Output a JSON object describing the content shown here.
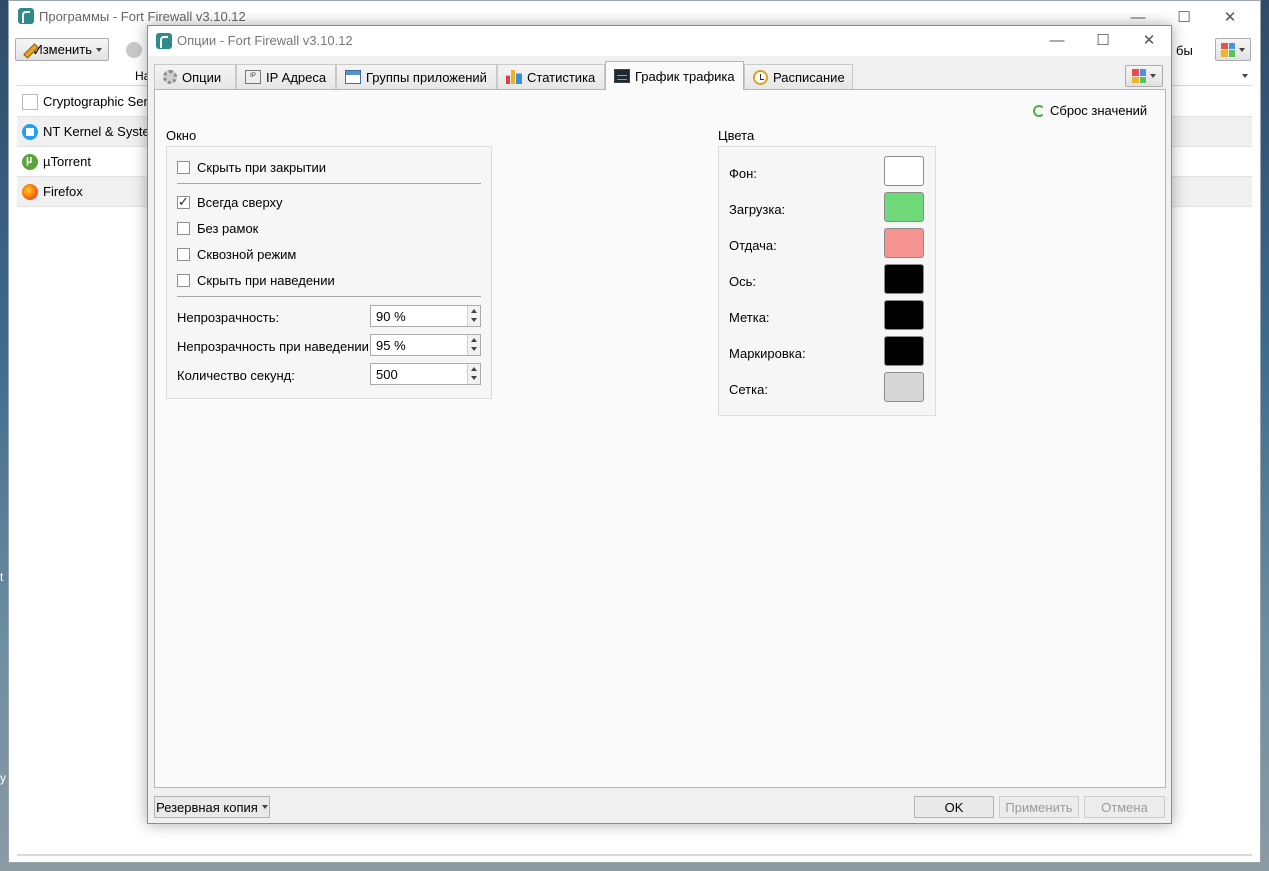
{
  "main_window": {
    "title": "Программы - Fort Firewall v3.10.12",
    "edit_button": "Изменить",
    "header_fragment": "На",
    "right_fragment": "бы",
    "programs": [
      {
        "name": "Cryptographic Servi",
        "icon": "document-icon"
      },
      {
        "name": "NT Kernel & Syster",
        "icon": "windows-icon"
      },
      {
        "name": "µTorrent",
        "icon": "utorrent-icon"
      },
      {
        "name": "Firefox",
        "icon": "firefox-icon"
      }
    ],
    "edge_chars": [
      "t",
      "y"
    ]
  },
  "dialog": {
    "title": "Опции - Fort Firewall v3.10.12",
    "tabs": [
      {
        "label": "Опции",
        "icon": "gear-icon"
      },
      {
        "label": "IP Адреса",
        "icon": "ip-icon"
      },
      {
        "label": "Группы приложений",
        "icon": "app-groups-icon"
      },
      {
        "label": "Статистика",
        "icon": "statistics-icon"
      },
      {
        "label": "График трафика",
        "icon": "traffic-graph-icon",
        "active": true
      },
      {
        "label": "Расписание",
        "icon": "clock-icon"
      }
    ],
    "reset_label": "Сброс значений",
    "window_group": {
      "title": "Окно",
      "checkboxes": [
        {
          "label": "Скрыть при закрытии",
          "checked": false
        },
        {
          "label": "Всегда сверху",
          "checked": true
        },
        {
          "label": "Без рамок",
          "checked": false
        },
        {
          "label": "Сквозной режим",
          "checked": false
        },
        {
          "label": "Скрыть при наведении",
          "checked": false
        }
      ],
      "spinners": [
        {
          "label": "Непрозрачность:",
          "value": "90 %"
        },
        {
          "label": "Непрозрачность при наведении:",
          "value": "95 %"
        },
        {
          "label": "Количество секунд:",
          "value": "500"
        }
      ]
    },
    "colors_group": {
      "title": "Цвета",
      "items": [
        {
          "label": "Фон:",
          "color": "#ffffff"
        },
        {
          "label": "Загрузка:",
          "color": "#6fd97a"
        },
        {
          "label": "Отдача:",
          "color": "#f5948f"
        },
        {
          "label": "Ось:",
          "color": "#000000"
        },
        {
          "label": "Метка:",
          "color": "#000000"
        },
        {
          "label": "Маркировка:",
          "color": "#000000"
        },
        {
          "label": "Сетка:",
          "color": "#d6d6d6"
        }
      ]
    },
    "backup_button": "Резервная копия",
    "ok_button": "OK",
    "apply_button": "Применить",
    "cancel_button": "Отмена"
  }
}
